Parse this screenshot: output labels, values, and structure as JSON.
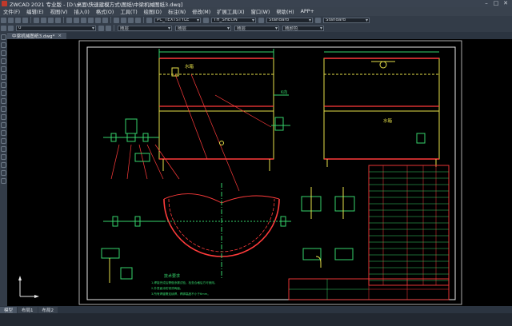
{
  "window": {
    "title": "ZWCAD 2021 专业版 - [D:\\桌面\\快速建模方式\\图纸\\中梁机械图纸3.dwg]"
  },
  "menu": [
    "文件(F)",
    "编辑(E)",
    "视图(V)",
    "插入(I)",
    "格式(O)",
    "工具(T)",
    "绘图(D)",
    "标注(N)",
    "修改(M)",
    "扩展工具(X)",
    "窗口(W)",
    "帮助(H)",
    "APP+"
  ],
  "toolbar": {
    "textstyle": "PC_TEXTSTYLE",
    "dimstyle": "TH_SHEON",
    "tablestyle": "Standard",
    "mlstyle": "Standard",
    "layer": "0",
    "color": "随层",
    "linetype": "随层",
    "lineweight": "随层",
    "plotstyle": "随颜色"
  },
  "doc_tab": {
    "label": "中梁机械图纸3.dwg*",
    "close": "×"
  },
  "layout_tabs": [
    "模型",
    "布局1",
    "布局2"
  ],
  "drawing_text": {
    "water_box": "水箱",
    "k_mark": "K向",
    "tech_title": "技术要求",
    "tech_lines": [
      "1.焊接完成后需做渗漏试验，检查合格后方可使用。",
      "2.外表面涂防锈漆两遍。",
      "3.所有焊缝需连续焊，焊脚高度不小于6mm。"
    ]
  }
}
